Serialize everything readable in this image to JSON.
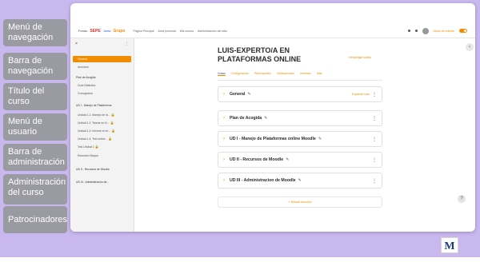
{
  "legend": [
    "Menú de navegación",
    "Barra de navegación",
    "Título del curso",
    "Menú de usuario",
    "Barra de administración",
    "Administración del curso",
    "Patrocinadores"
  ],
  "topbar": {
    "brand": [
      "Fondo",
      "SEPE",
      "Junta",
      "Grupo"
    ],
    "links": [
      "Página Principal",
      "Área personal",
      "Mis cursos",
      "Administración del sitio"
    ],
    "edit_mode": "Modo de edición"
  },
  "sidebar": {
    "close": "×",
    "menu": "⋮",
    "items": [
      {
        "label": "General",
        "active": true
      },
      {
        "label": "Anuncios"
      },
      {
        "label": "Plan de Acogida",
        "section": true
      },
      {
        "label": "Guía Didáctica"
      },
      {
        "label": "Cronograma"
      },
      {
        "label": "UD I - Manejo de Plataformas",
        "section": true
      },
      {
        "label": "Unidad 1.1: Manejo de la...",
        "locked": true
      },
      {
        "label": "Unidad 1.2: Tareas en el...",
        "locked": true
      },
      {
        "label": "Unidad 1.3: Informe en el...",
        "locked": true
      },
      {
        "label": "Unidad 1.4: Test online...",
        "locked": true
      },
      {
        "label": "Test Unidad 1",
        "locked": true
      },
      {
        "label": "Resumen Bloque"
      },
      {
        "label": "UD II - Recursos de Moodle",
        "section": true
      },
      {
        "label": "UD III - Administración de...",
        "section": true
      }
    ]
  },
  "course": {
    "title": "LUIS-EXPERTO/A EN PLATAFORMAS ONLINE",
    "editor_link": "Desplegar todas",
    "tabs": [
      "Curso",
      "Configuración",
      "Participantes",
      "Calificaciones",
      "Informes",
      "Más"
    ]
  },
  "sections": [
    {
      "title": "General",
      "right": "Expandir todo"
    },
    {
      "title": "Plan de Acogida",
      "right": ""
    },
    {
      "title": "UD I - Manejo de Plataformas online Moodle",
      "right": ""
    },
    {
      "title": "UD II - Recursos de Moodle",
      "right": ""
    },
    {
      "title": "UD III - Administracion de Moodle",
      "right": ""
    }
  ],
  "add_section": "+ Añadir sección",
  "help": "?",
  "drawer": "‹",
  "logo_text": "M",
  "colors": {
    "background": "#c9b8ee",
    "legend_box": "#9a9aa2",
    "accent": "#f28c00"
  }
}
